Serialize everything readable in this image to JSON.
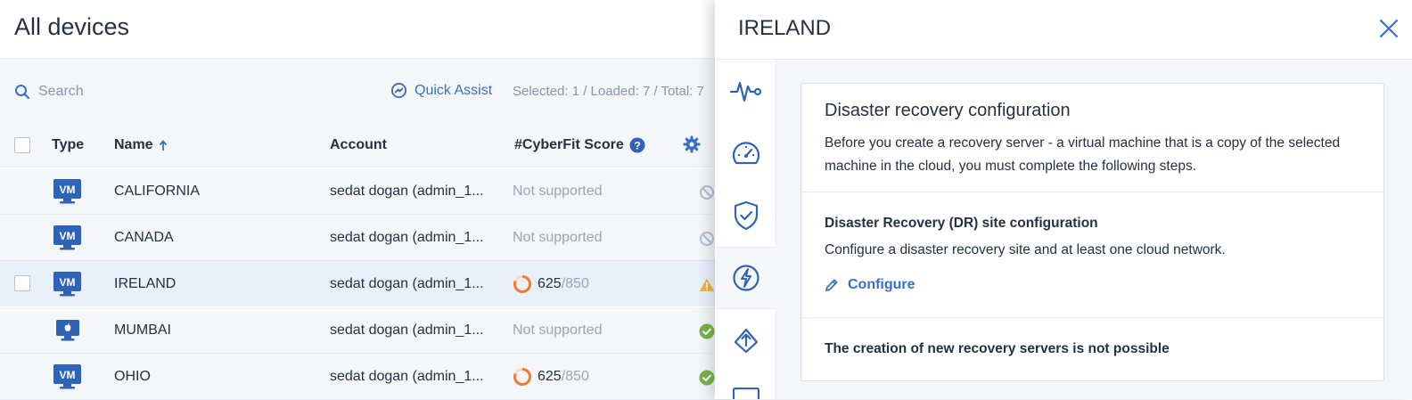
{
  "page": {
    "title": "All devices"
  },
  "toolbar": {
    "search_placeholder": "Search",
    "quick_assist": "Quick Assist",
    "counts": "Selected: 1 / Loaded: 7 / Total: 7"
  },
  "table": {
    "headers": {
      "type": "Type",
      "name": "Name",
      "account": "Account",
      "score": "#CyberFit Score"
    },
    "rows": [
      {
        "type_icon": "vm-icon",
        "type_label": "VM",
        "name": "CALIFORNIA",
        "account": "sedat dogan (admin_1...",
        "score_text": "Not supported",
        "score": "",
        "score_max": "",
        "status_icon": "not-supported-icon"
      },
      {
        "type_icon": "vm-icon",
        "type_label": "VM",
        "name": "CANADA",
        "account": "sedat dogan (admin_1...",
        "score_text": "Not supported",
        "score": "",
        "score_max": "",
        "status_icon": "not-supported-icon"
      },
      {
        "type_icon": "vm-icon",
        "type_label": "VM",
        "name": "IRELAND",
        "account": "sedat dogan (admin_1...",
        "score_text": "",
        "score": "625",
        "score_max": "/850",
        "status_icon": "warning-icon"
      },
      {
        "type_icon": "apple-icon",
        "type_label": "",
        "name": "MUMBAI",
        "account": "sedat dogan (admin_1...",
        "score_text": "Not supported",
        "score": "",
        "score_max": "",
        "status_icon": "ok-icon"
      },
      {
        "type_icon": "vm-icon",
        "type_label": "VM",
        "name": "OHIO",
        "account": "sedat dogan (admin_1...",
        "score_text": "",
        "score": "625",
        "score_max": "/850",
        "status_icon": "ok-icon"
      }
    ]
  },
  "panel": {
    "title": "IRELAND",
    "rail": [
      "pulse-icon",
      "gauge-icon",
      "shield-check-icon",
      "lightning-icon",
      "recovery-icon",
      "more-icon"
    ],
    "dr": {
      "title": "Disaster recovery configuration",
      "description": "Before you create a recovery server - a virtual machine that is a copy of the selected machine in the cloud, you must complete the following steps.",
      "site_title": "Disaster Recovery (DR) site configuration",
      "site_description": "Configure a disaster recovery site and at least one cloud network.",
      "configure_label": "Configure",
      "not_possible": "The creation of new recovery servers is not possible"
    }
  },
  "colors": {
    "accent": "#3a6fc4",
    "vm_badge": "#2f63b8",
    "score_ring": "#f07a2a",
    "warning": "#f2b33d",
    "ok": "#7cb342",
    "muted": "#9aa5b5"
  }
}
